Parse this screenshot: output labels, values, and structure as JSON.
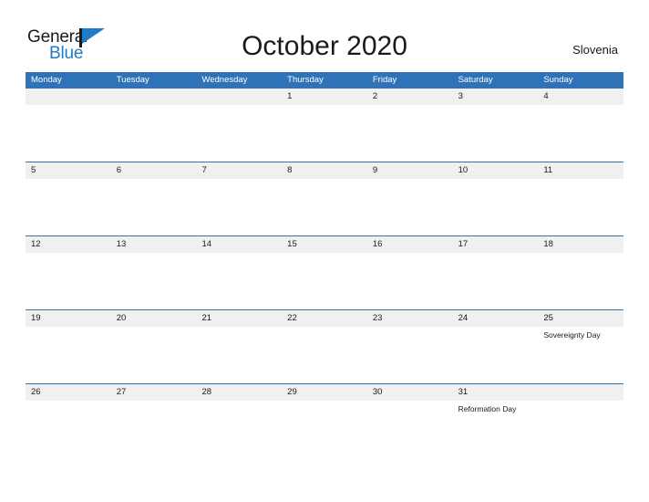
{
  "brand": {
    "name_part1": "General",
    "name_part2": "Blue",
    "flag_icon": "blue-triangle-flag-icon",
    "color_dark": "#1a1a1a",
    "color_blue": "#1f7ac7"
  },
  "header": {
    "title": "October 2020",
    "country": "Slovenia"
  },
  "theme": {
    "header_blue": "#2e72b8",
    "band_gray": "#f0f0f0",
    "page_background": "#ffffff",
    "text": "#1a1a1a"
  },
  "calendar": {
    "month": "October",
    "year": "2020",
    "weekdays": [
      "Monday",
      "Tuesday",
      "Wednesday",
      "Thursday",
      "Friday",
      "Saturday",
      "Sunday"
    ],
    "weeks": [
      [
        {
          "num": "",
          "event": ""
        },
        {
          "num": "",
          "event": ""
        },
        {
          "num": "",
          "event": ""
        },
        {
          "num": "1",
          "event": ""
        },
        {
          "num": "2",
          "event": ""
        },
        {
          "num": "3",
          "event": ""
        },
        {
          "num": "4",
          "event": ""
        }
      ],
      [
        {
          "num": "5",
          "event": ""
        },
        {
          "num": "6",
          "event": ""
        },
        {
          "num": "7",
          "event": ""
        },
        {
          "num": "8",
          "event": ""
        },
        {
          "num": "9",
          "event": ""
        },
        {
          "num": "10",
          "event": ""
        },
        {
          "num": "11",
          "event": ""
        }
      ],
      [
        {
          "num": "12",
          "event": ""
        },
        {
          "num": "13",
          "event": ""
        },
        {
          "num": "14",
          "event": ""
        },
        {
          "num": "15",
          "event": ""
        },
        {
          "num": "16",
          "event": ""
        },
        {
          "num": "17",
          "event": ""
        },
        {
          "num": "18",
          "event": ""
        }
      ],
      [
        {
          "num": "19",
          "event": ""
        },
        {
          "num": "20",
          "event": ""
        },
        {
          "num": "21",
          "event": ""
        },
        {
          "num": "22",
          "event": ""
        },
        {
          "num": "23",
          "event": ""
        },
        {
          "num": "24",
          "event": ""
        },
        {
          "num": "25",
          "event": "Sovereignty Day"
        }
      ],
      [
        {
          "num": "26",
          "event": ""
        },
        {
          "num": "27",
          "event": ""
        },
        {
          "num": "28",
          "event": ""
        },
        {
          "num": "29",
          "event": ""
        },
        {
          "num": "30",
          "event": ""
        },
        {
          "num": "31",
          "event": "Reformation Day"
        },
        {
          "num": "",
          "event": ""
        }
      ]
    ]
  }
}
